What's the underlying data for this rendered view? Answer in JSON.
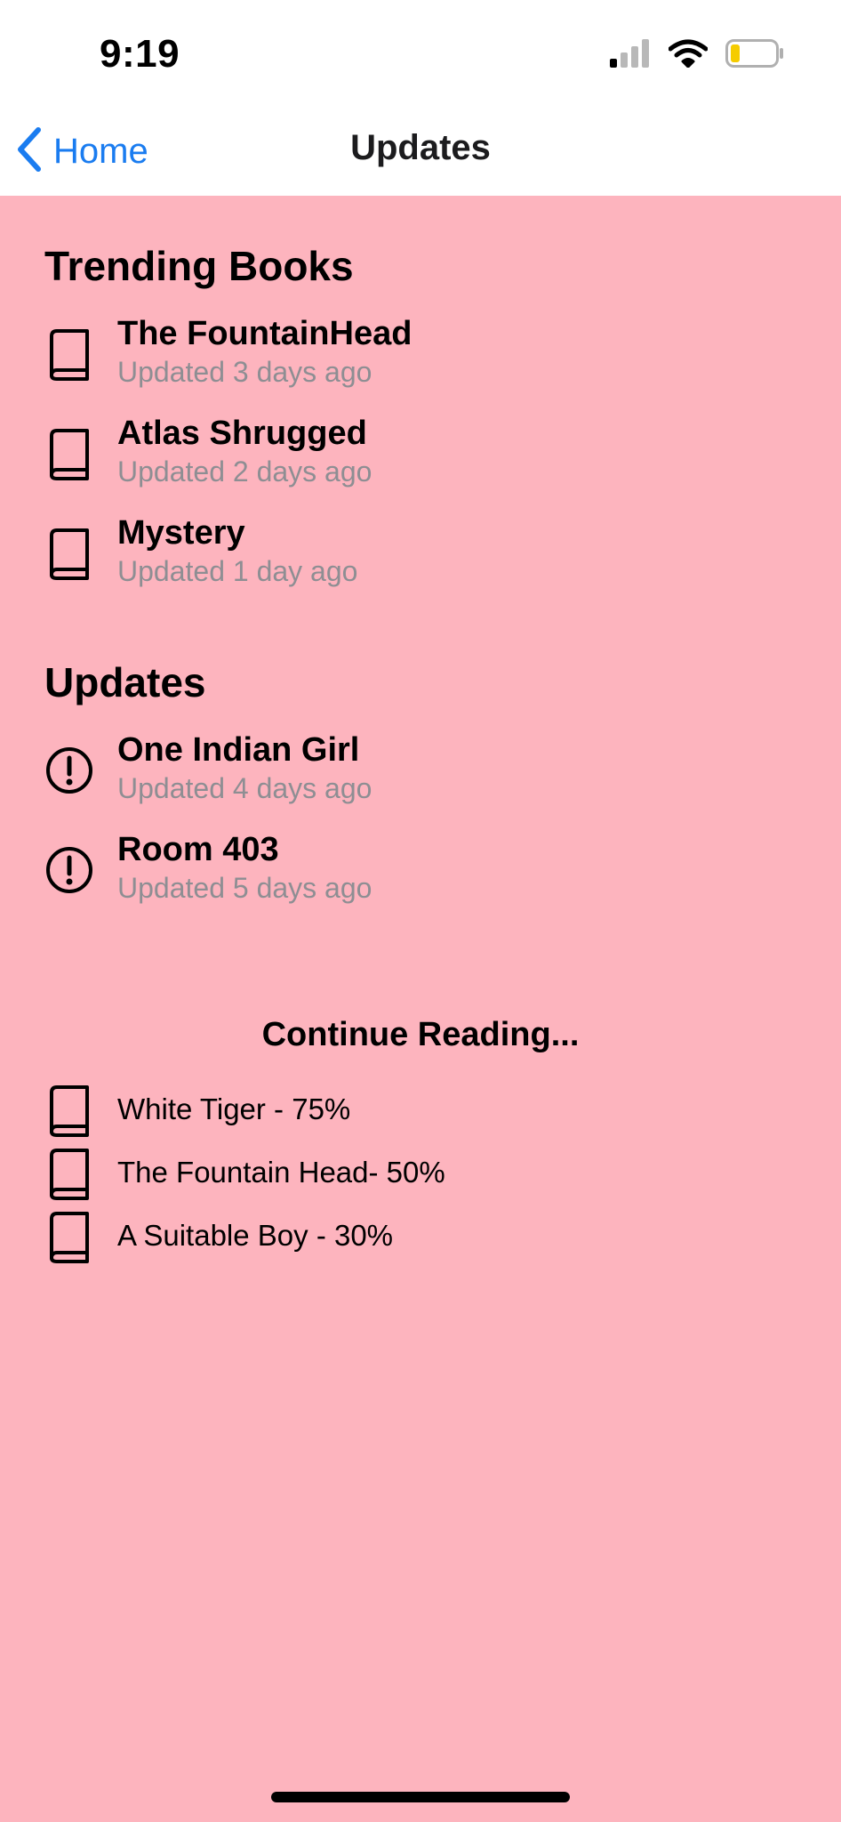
{
  "status_bar": {
    "time": "9:19",
    "icons": [
      "signal-icon",
      "wifi-icon",
      "battery-low-icon"
    ],
    "battery_color": "#f5cc00"
  },
  "nav": {
    "back_label": "Home",
    "title": "Updates",
    "accent_color": "#1a7cf0"
  },
  "background_color": "#fdb4be",
  "trending": {
    "title": "Trending Books",
    "icon": "book-icon",
    "items": [
      {
        "title": "The FountainHead",
        "subtitle": "Updated 3 days ago"
      },
      {
        "title": "Atlas Shrugged",
        "subtitle": "Updated 2 days ago"
      },
      {
        "title": "Mystery",
        "subtitle": "Updated 1 day ago"
      }
    ]
  },
  "updates": {
    "title": "Updates",
    "icon": "exclamation-circle-icon",
    "items": [
      {
        "title": "One Indian Girl",
        "subtitle": "Updated 4 days ago"
      },
      {
        "title": "Room 403",
        "subtitle": "Updated 5 days ago"
      }
    ]
  },
  "continue_reading": {
    "title": "Continue Reading...",
    "icon": "book-icon",
    "items": [
      {
        "label": "White Tiger - 75%",
        "progress": 75
      },
      {
        "label": "The Fountain Head- 50%",
        "progress": 50
      },
      {
        "label": "A Suitable Boy - 30%",
        "progress": 30
      }
    ]
  }
}
